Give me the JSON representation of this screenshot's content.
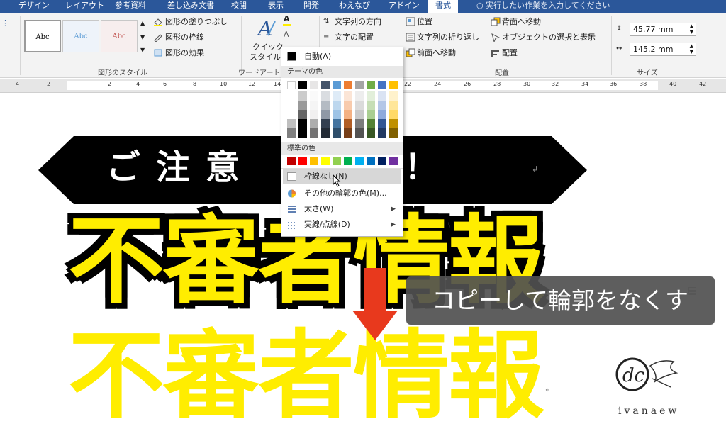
{
  "tabs": [
    "デザイン",
    "レイアウト",
    "参考資料",
    "差し込み文書",
    "校閲",
    "表示",
    "開発",
    "わえなび",
    "アドイン",
    "書式"
  ],
  "active_tab": "書式",
  "tell_me": "実行したい作業を入力してください",
  "ribbon": {
    "shape_styles": {
      "preset_label": "Abc",
      "fill": "図形の塗りつぶし",
      "outline": "図形の枠線",
      "effects": "図形の効果",
      "group_label": "図形のスタイル"
    },
    "wordart": {
      "quick_style_line1": "クイック",
      "quick_style_line2": "スタイル",
      "group_label": "ワードアートの"
    },
    "text": {
      "direction": "文字列の方向",
      "align": "文字の配置"
    },
    "arrange": {
      "position": "位置",
      "wrap": "文字列の折り返し",
      "bring_forward": "前面へ移動",
      "send_backward": "背面へ移動",
      "selection_pane": "オブジェクトの選択と表示",
      "align": "配置",
      "group_label": "配置"
    },
    "size": {
      "height": "45.77 mm",
      "width": "145.2 mm",
      "group_label": "サイズ"
    }
  },
  "ruler_numbers": [
    "4",
    "2",
    "2",
    "4",
    "6",
    "8",
    "10",
    "12",
    "14",
    "22",
    "24",
    "26",
    "28",
    "30",
    "32",
    "34",
    "36",
    "38",
    "40",
    "42"
  ],
  "document": {
    "banner_text": "ご注意　さい！",
    "heading_outlined": "不審者情報",
    "heading_plain": "不審者情報",
    "caption": "コピーして輪郭をなくす",
    "logo_text": "ivanaew"
  },
  "dropdown": {
    "auto": "自動(A)",
    "theme_header": "テーマの色",
    "standard_header": "標準の色",
    "no_outline": "枠線なし(N)",
    "more_colors": "その他の輪郭の色(M)...",
    "weight": "太さ(W)",
    "dashes": "実線/点線(D)",
    "theme_colors": [
      "#ffffff",
      "#000000",
      "#e7e6e6",
      "#44546a",
      "#5b9bd5",
      "#ed7d31",
      "#a5a5a5",
      "#70ad47",
      "#4472c4",
      "#ffc000"
    ],
    "standard_colors": [
      "#c00000",
      "#ff0000",
      "#ffc000",
      "#ffff00",
      "#92d050",
      "#00b050",
      "#00b0f0",
      "#0070c0",
      "#002060",
      "#7030a0"
    ]
  },
  "colors": {
    "ribbon_tab": "#2b579a",
    "heading_yellow": "#ffed00",
    "arrow_red": "#e8391d",
    "caption_bg": "#505050"
  }
}
